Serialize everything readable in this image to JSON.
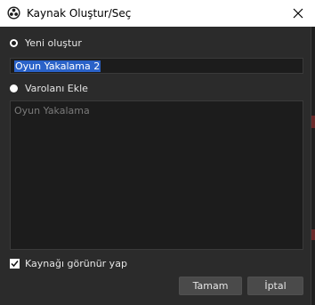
{
  "window": {
    "title": "Kaynak Oluştur/Seç",
    "close_icon": "close-icon"
  },
  "new_option": {
    "label": "Yeni oluştur",
    "selected": true
  },
  "name_input": {
    "value": "Oyun Yakalama 2"
  },
  "existing_option": {
    "label": "Varolanı Ekle",
    "selected": false
  },
  "existing_list": {
    "items": [
      "Oyun Yakalama"
    ]
  },
  "visible_checkbox": {
    "label": "Kaynağı görünür yap",
    "checked": true
  },
  "buttons": {
    "ok": "Tamam",
    "cancel": "İptal"
  },
  "colors": {
    "selection": "#2a62c8",
    "background": "#2b2b2b",
    "field": "#1c1c1c"
  }
}
